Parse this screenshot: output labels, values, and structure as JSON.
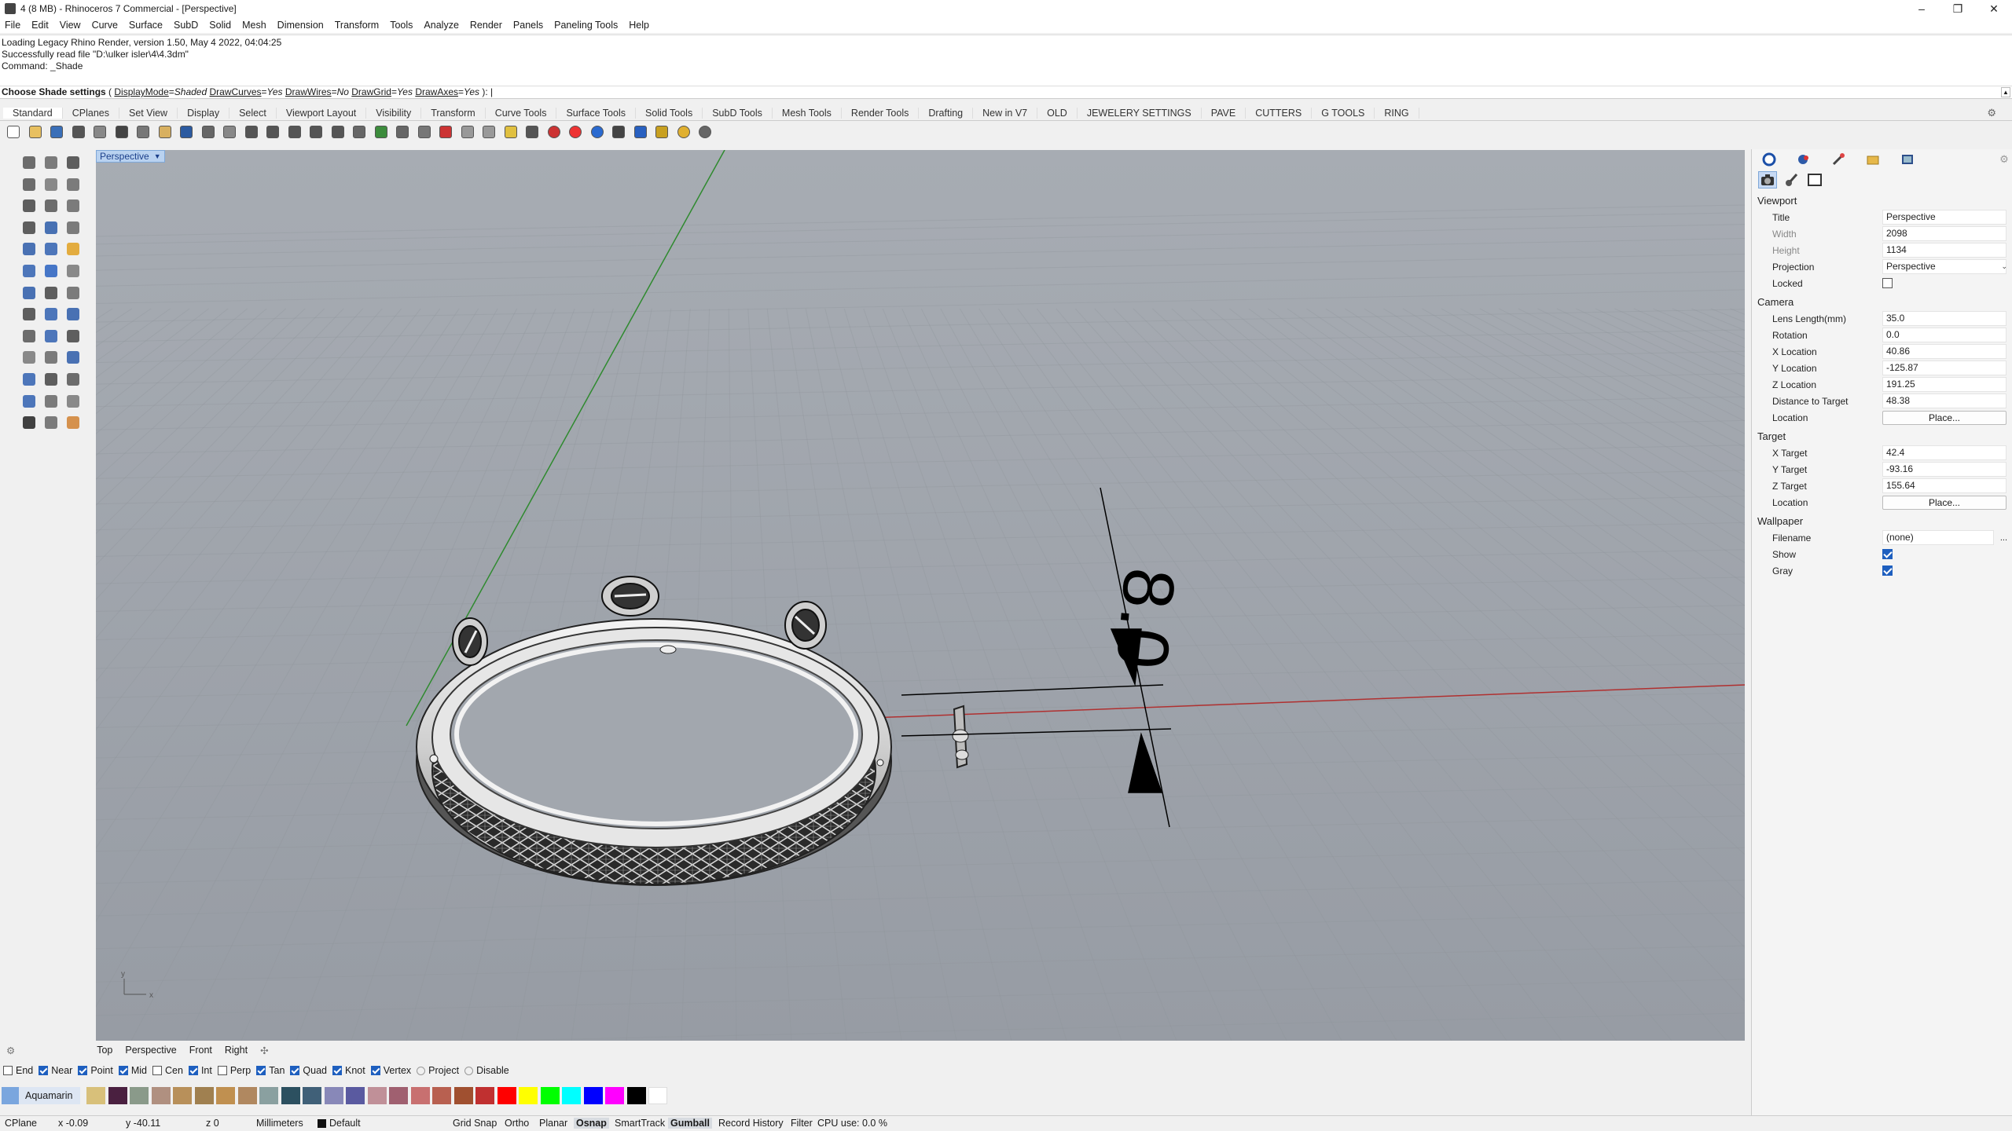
{
  "window": {
    "title": "4 (8 MB) - Rhinoceros 7 Commercial - [Perspective]",
    "controls": [
      "–",
      "❐",
      "✕"
    ]
  },
  "menu": [
    "File",
    "Edit",
    "View",
    "Curve",
    "Surface",
    "SubD",
    "Solid",
    "Mesh",
    "Dimension",
    "Transform",
    "Tools",
    "Analyze",
    "Render",
    "Panels",
    "Paneling Tools",
    "Help"
  ],
  "command_history": [
    "Loading Legacy Rhino Render, version 1.50, May  4 2022, 04:04:25",
    "Successfully read file \"D:\\ulker isler\\4\\4.3dm\"",
    "Command: _Shade"
  ],
  "command_prompt": {
    "label": "Choose Shade settings",
    "options": [
      {
        "name": "DisplayMode",
        "value": "Shaded"
      },
      {
        "name": "DrawCurves",
        "value": "Yes"
      },
      {
        "name": "DrawWires",
        "value": "No"
      },
      {
        "name": "DrawGrid",
        "value": "Yes"
      },
      {
        "name": "DrawAxes",
        "value": "Yes"
      }
    ]
  },
  "toolbar_tabs": [
    "Standard",
    "CPlanes",
    "Set View",
    "Display",
    "Select",
    "Viewport Layout",
    "Visibility",
    "Transform",
    "Curve Tools",
    "Surface Tools",
    "Solid Tools",
    "SubD Tools",
    "Mesh Tools",
    "Render Tools",
    "Drafting",
    "New in V7",
    "OLD",
    "JEWELERY SETTINGS",
    "PAVE",
    "CUTTERS",
    "G TOOLS",
    "RING"
  ],
  "toolbar_icons": [
    "new-icon",
    "open-icon",
    "save-icon",
    "print-icon",
    "import-icon",
    "cut-icon",
    "copy-icon",
    "paste-icon",
    "undo-icon",
    "pan-icon",
    "move-view-icon",
    "zoom-icon",
    "zoom-window-icon",
    "zoom-extents-icon",
    "zoom-selected-icon",
    "rotate-view-icon",
    "viewport-layout-icon",
    "cplane-icon",
    "grid-icon",
    "hide-icon",
    "show-icon",
    "lock-icon",
    "unlock-icon",
    "layer-icon",
    "material-icon",
    "color-icon",
    "render-sphere-icon",
    "render-blue-icon",
    "light-icon",
    "options-icon",
    "dimension-icon",
    "globe-icon",
    "help-icon"
  ],
  "left_tools": [
    "select-icon",
    "point-icon",
    "line-icon",
    "polyline-icon",
    "circle-icon",
    "arc-icon",
    "rectangle-icon",
    "ellipse-icon",
    "polygon-icon",
    "curve-icon",
    "fillet-icon",
    "offset-icon",
    "surface-icon",
    "extrude-icon",
    "loft-icon",
    "box-icon",
    "sphere-icon",
    "cylinder-icon",
    "boolean-icon",
    "split-icon",
    "trim-icon",
    "explode-icon",
    "join-icon",
    "group-icon",
    "move-icon",
    "rotate-icon",
    "scale-icon",
    "mirror-icon",
    "array-icon",
    "align-icon",
    "text-icon",
    "dimension-icon",
    "hatch-icon",
    "analyze-icon",
    "render-icon",
    "snap-icon",
    "check-icon",
    "mesh-icon",
    "paint-icon"
  ],
  "viewport": {
    "name": "Perspective",
    "dimension_text": "8.0",
    "axis_labels": {
      "x": "x",
      "y": "y"
    }
  },
  "view_tabs": [
    "Top",
    "Perspective",
    "Front",
    "Right"
  ],
  "properties": {
    "viewport_header": "Viewport",
    "viewport": [
      {
        "label": "Title",
        "value": "Perspective"
      },
      {
        "label": "Width",
        "value": "2098"
      },
      {
        "label": "Height",
        "value": "1134"
      },
      {
        "label": "Projection",
        "value": "Perspective"
      },
      {
        "label": "Locked",
        "checked": false
      }
    ],
    "camera_header": "Camera",
    "camera": [
      {
        "label": "Lens Length(mm)",
        "value": "35.0"
      },
      {
        "label": "Rotation",
        "value": "0.0"
      },
      {
        "label": "X Location",
        "value": "40.86"
      },
      {
        "label": "Y Location",
        "value": "-125.87"
      },
      {
        "label": "Z Location",
        "value": "191.25"
      },
      {
        "label": "Distance to Target",
        "value": "48.38"
      },
      {
        "label": "Location",
        "button": "Place..."
      }
    ],
    "target_header": "Target",
    "target": [
      {
        "label": "X Target",
        "value": "42.4"
      },
      {
        "label": "Y Target",
        "value": "-93.16"
      },
      {
        "label": "Z Target",
        "value": "155.64"
      },
      {
        "label": "Location",
        "button": "Place..."
      }
    ],
    "wallpaper_header": "Wallpaper",
    "wallpaper": [
      {
        "label": "Filename",
        "value": "(none)",
        "more": "..."
      },
      {
        "label": "Show",
        "checked": true
      },
      {
        "label": "Gray",
        "checked": true
      }
    ]
  },
  "osnaps": [
    {
      "label": "End",
      "checked": false
    },
    {
      "label": "Near",
      "checked": true
    },
    {
      "label": "Point",
      "checked": true
    },
    {
      "label": "Mid",
      "checked": true
    },
    {
      "label": "Cen",
      "checked": false
    },
    {
      "label": "Int",
      "checked": true
    },
    {
      "label": "Perp",
      "checked": false
    },
    {
      "label": "Tan",
      "checked": true
    },
    {
      "label": "Quad",
      "checked": true
    },
    {
      "label": "Knot",
      "checked": true
    },
    {
      "label": "Vertex",
      "checked": true
    },
    {
      "label": "Project",
      "radio": true
    },
    {
      "label": "Disable",
      "radio": true
    }
  ],
  "current_layer": {
    "name": "Aquamarin",
    "color": "#7aa6de"
  },
  "layer_swatches": [
    "#d8c07a",
    "#4a2040",
    "#8a9a8a",
    "#b09080",
    "#b8905a",
    "#a08050",
    "#c09050",
    "#b08860",
    "#8aa0a0",
    "#2c5060",
    "#406078",
    "#8888b8",
    "#5a5aa0",
    "#c09098",
    "#a06070",
    "#c87070",
    "#b86050",
    "#a05030",
    "#c03030",
    "#ff0000",
    "#ffff00",
    "#00ff00",
    "#00ffff",
    "#0000ff",
    "#ff00ff",
    "#000000",
    "#ffffff"
  ],
  "status": {
    "cplane": "CPlane",
    "x": "x -0.09",
    "y": "y -40.11",
    "z": "z 0",
    "units": "Millimeters",
    "layer": "Default",
    "toggles": [
      {
        "label": "Grid Snap",
        "on": false
      },
      {
        "label": "Ortho",
        "on": false
      },
      {
        "label": "Planar",
        "on": false
      },
      {
        "label": "Osnap",
        "on": true
      },
      {
        "label": "SmartTrack",
        "on": false
      },
      {
        "label": "Gumball",
        "on": true
      },
      {
        "label": "Record History",
        "on": false
      },
      {
        "label": "Filter",
        "on": false
      }
    ],
    "cpu": "CPU use: 0.0 %"
  }
}
